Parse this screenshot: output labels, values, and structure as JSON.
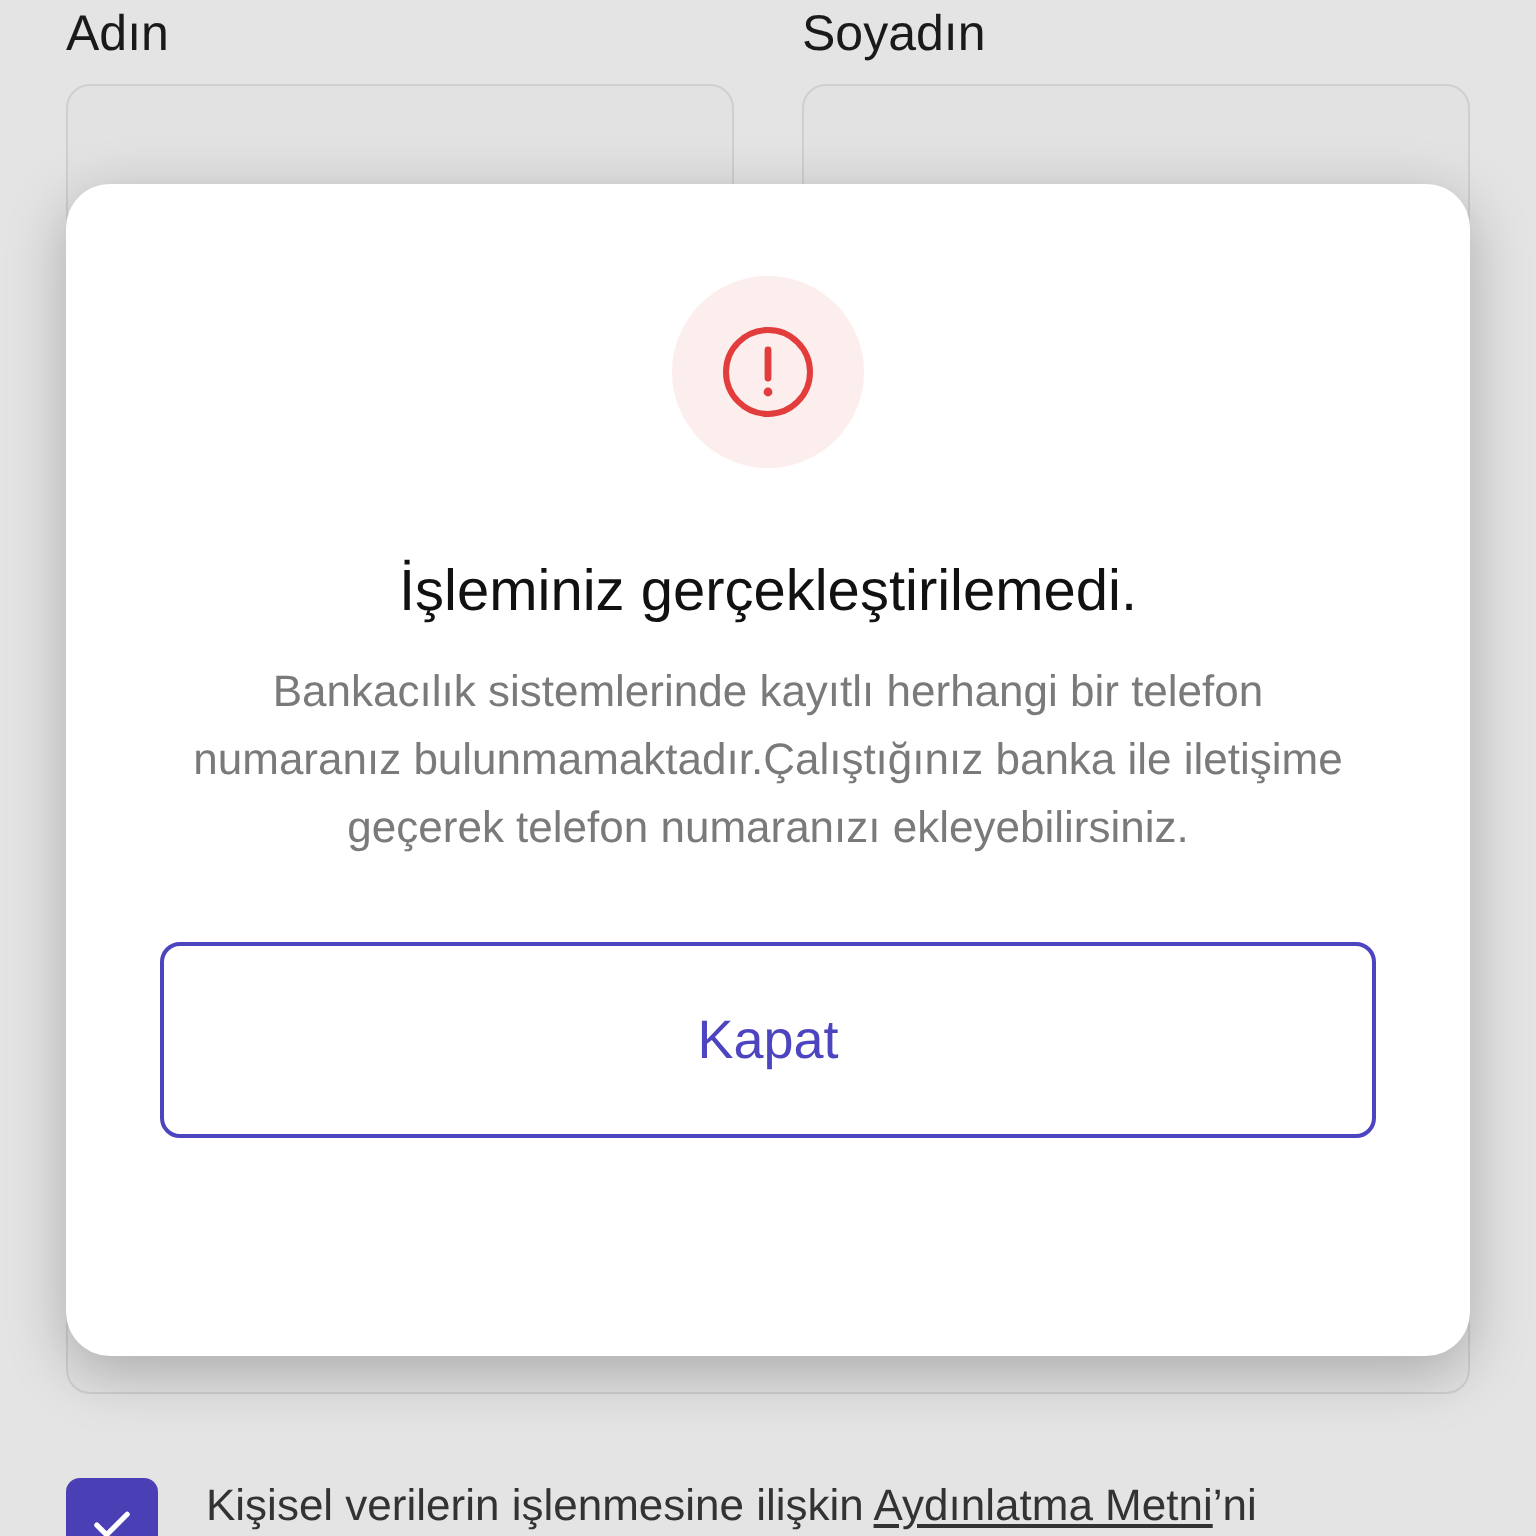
{
  "form": {
    "fields": [
      {
        "label": "Adın"
      },
      {
        "label": "Soyadın"
      }
    ],
    "consent": {
      "checked": true,
      "text_before": "Kişisel verilerin işlenmesine ilişkin ",
      "link": "Aydınlatma Metni",
      "text_after": "’ni"
    }
  },
  "dialog": {
    "title": "İşleminiz gerçekleştirilemedi.",
    "message": "Bankacılık sistemlerinde kayıtlı herhangi bir telefon numaranız bulunmamaktadır.Çalıştığınız banka ile iletişime geçerek telefon numaranızı ekleyebilirsiniz.",
    "button": "Kapat"
  }
}
